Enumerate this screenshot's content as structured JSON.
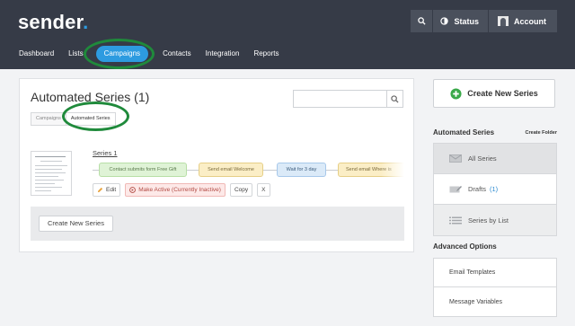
{
  "app": {
    "logo": "sender",
    "logo_dot": "."
  },
  "topbar": {
    "status_label": "Status",
    "account_label": "Account"
  },
  "nav": {
    "items": [
      "Dashboard",
      "Lists",
      "Campaigns",
      "Contacts",
      "Integration",
      "Reports"
    ],
    "active": "Campaigns"
  },
  "main": {
    "title": "Automated Series (1)",
    "search_placeholder": "",
    "breadcrumbs": [
      "Campaigns",
      "Automated Series"
    ],
    "series": {
      "name": "Series 1",
      "steps": [
        "Contact submits form Free Gift",
        "Send email Welcome",
        "Wait for 3 day",
        "Send email Where is"
      ],
      "actions": {
        "edit": "Edit",
        "activate": "Make Active (Currently Inactive)",
        "copy": "Copy",
        "delete": "X"
      }
    },
    "create_button": "Create New Series"
  },
  "sidebar": {
    "create_button": "Create New Series",
    "section_title": "Automated Series",
    "create_folder": "Create Folder",
    "items": [
      {
        "label": "All Series",
        "icon": "envelope-icon"
      },
      {
        "label": "Drafts",
        "count": "(1)",
        "icon": "pencil-icon"
      },
      {
        "label": "Series by List",
        "icon": "list-icon"
      }
    ],
    "advanced_title": "Advanced Options",
    "advanced_items": [
      "Email Templates",
      "Message Variables"
    ]
  },
  "colors": {
    "topbar": "#363b47",
    "accent": "#2d9be0",
    "highlight_ring": "#1f8a3b",
    "create_icon": "#3aa94a"
  }
}
